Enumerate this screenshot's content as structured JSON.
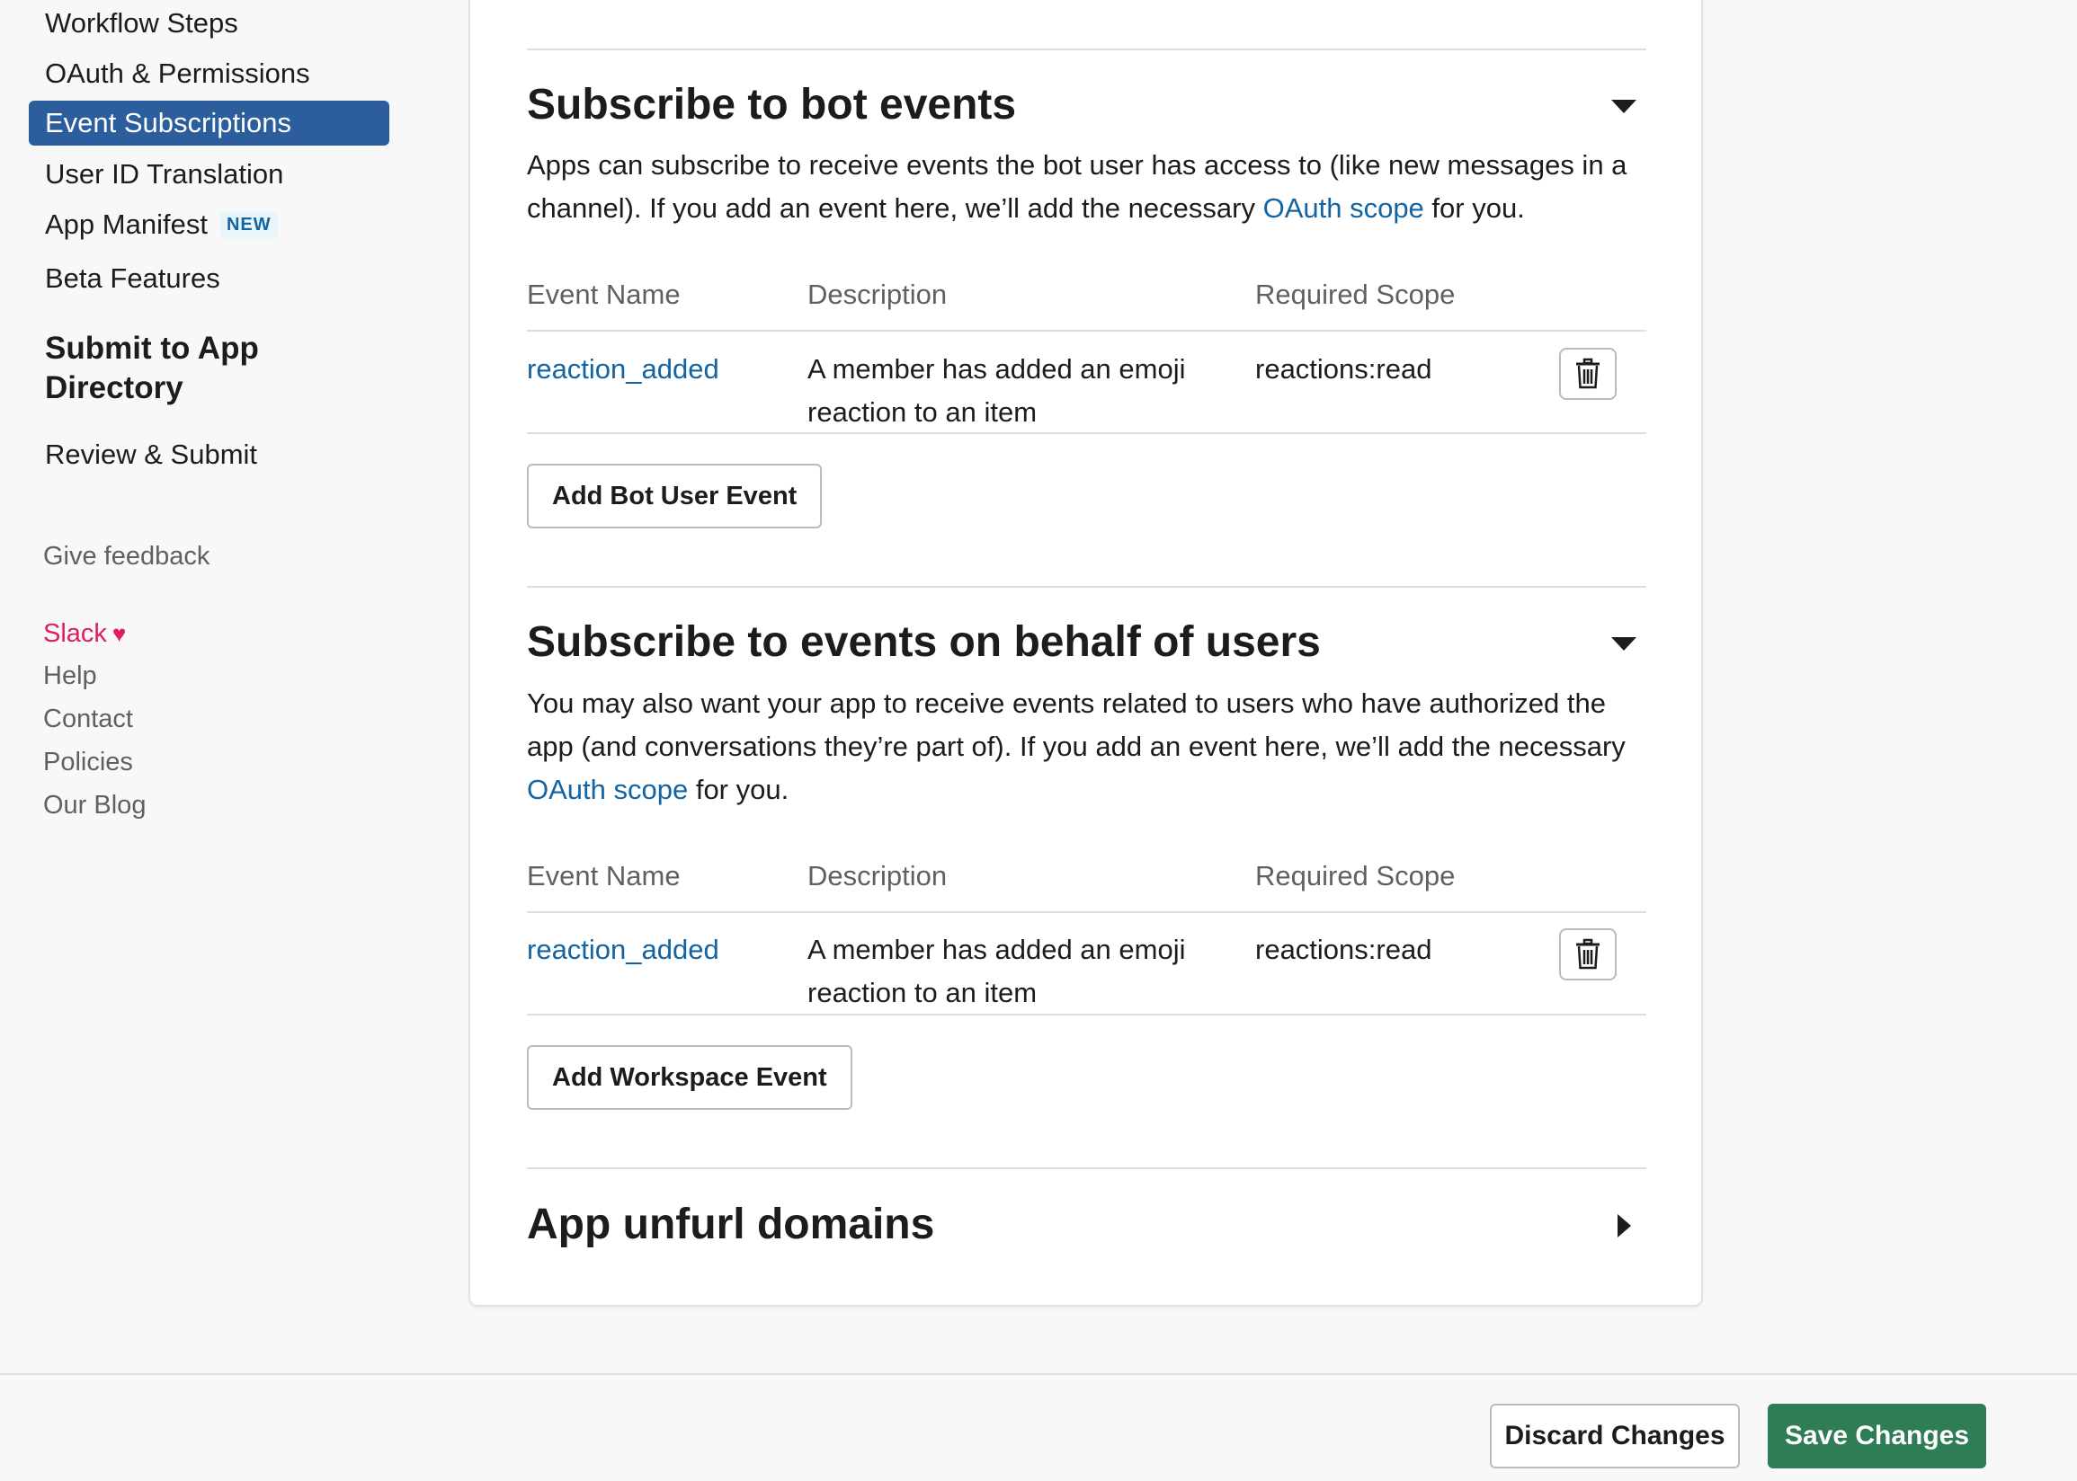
{
  "sidebar": {
    "items": [
      {
        "label": "Workflow Steps"
      },
      {
        "label": "OAuth & Permissions"
      },
      {
        "label": "Event Subscriptions",
        "active": true
      },
      {
        "label": "User ID Translation"
      },
      {
        "label": "App Manifest",
        "badge": "NEW"
      },
      {
        "label": "Beta Features"
      }
    ],
    "submit_heading": "Submit to App Directory",
    "review_submit": "Review & Submit",
    "give_feedback": "Give feedback",
    "footer_links": {
      "slack": "Slack",
      "help": "Help",
      "contact": "Contact",
      "policies": "Policies",
      "blog": "Our Blog"
    }
  },
  "bot_events": {
    "title": "Subscribe to bot events",
    "desc_before": "Apps can subscribe to receive events the bot user has access to (like new messages in a channel). If you add an event here, we’ll add the necessary ",
    "desc_link": "OAuth scope",
    "desc_after": " for you.",
    "columns": {
      "name": "Event Name",
      "description": "Description",
      "scope": "Required Scope"
    },
    "rows": [
      {
        "name": "reaction_added",
        "description": "A member has added an emoji reaction to an item",
        "scope": "reactions:read"
      }
    ],
    "add_button": "Add Bot User Event"
  },
  "user_events": {
    "title": "Subscribe to events on behalf of users",
    "desc_before": "You may also want your app to receive events related to users who have authorized the app (and conversations they’re part of). If you add an event here, we’ll add the necessary ",
    "desc_link": "OAuth scope",
    "desc_after": " for you.",
    "columns": {
      "name": "Event Name",
      "description": "Description",
      "scope": "Required Scope"
    },
    "rows": [
      {
        "name": "reaction_added",
        "description": "A member has added an emoji reaction to an item",
        "scope": "reactions:read"
      }
    ],
    "add_button": "Add Workspace Event"
  },
  "unfurl": {
    "title": "App unfurl domains"
  },
  "footer": {
    "discard": "Discard Changes",
    "save": "Save Changes"
  },
  "colors": {
    "active_nav": "#2c5e9e",
    "link": "#1264a3",
    "save_button": "#2e7d55",
    "slack_pink": "#e01e5a"
  }
}
